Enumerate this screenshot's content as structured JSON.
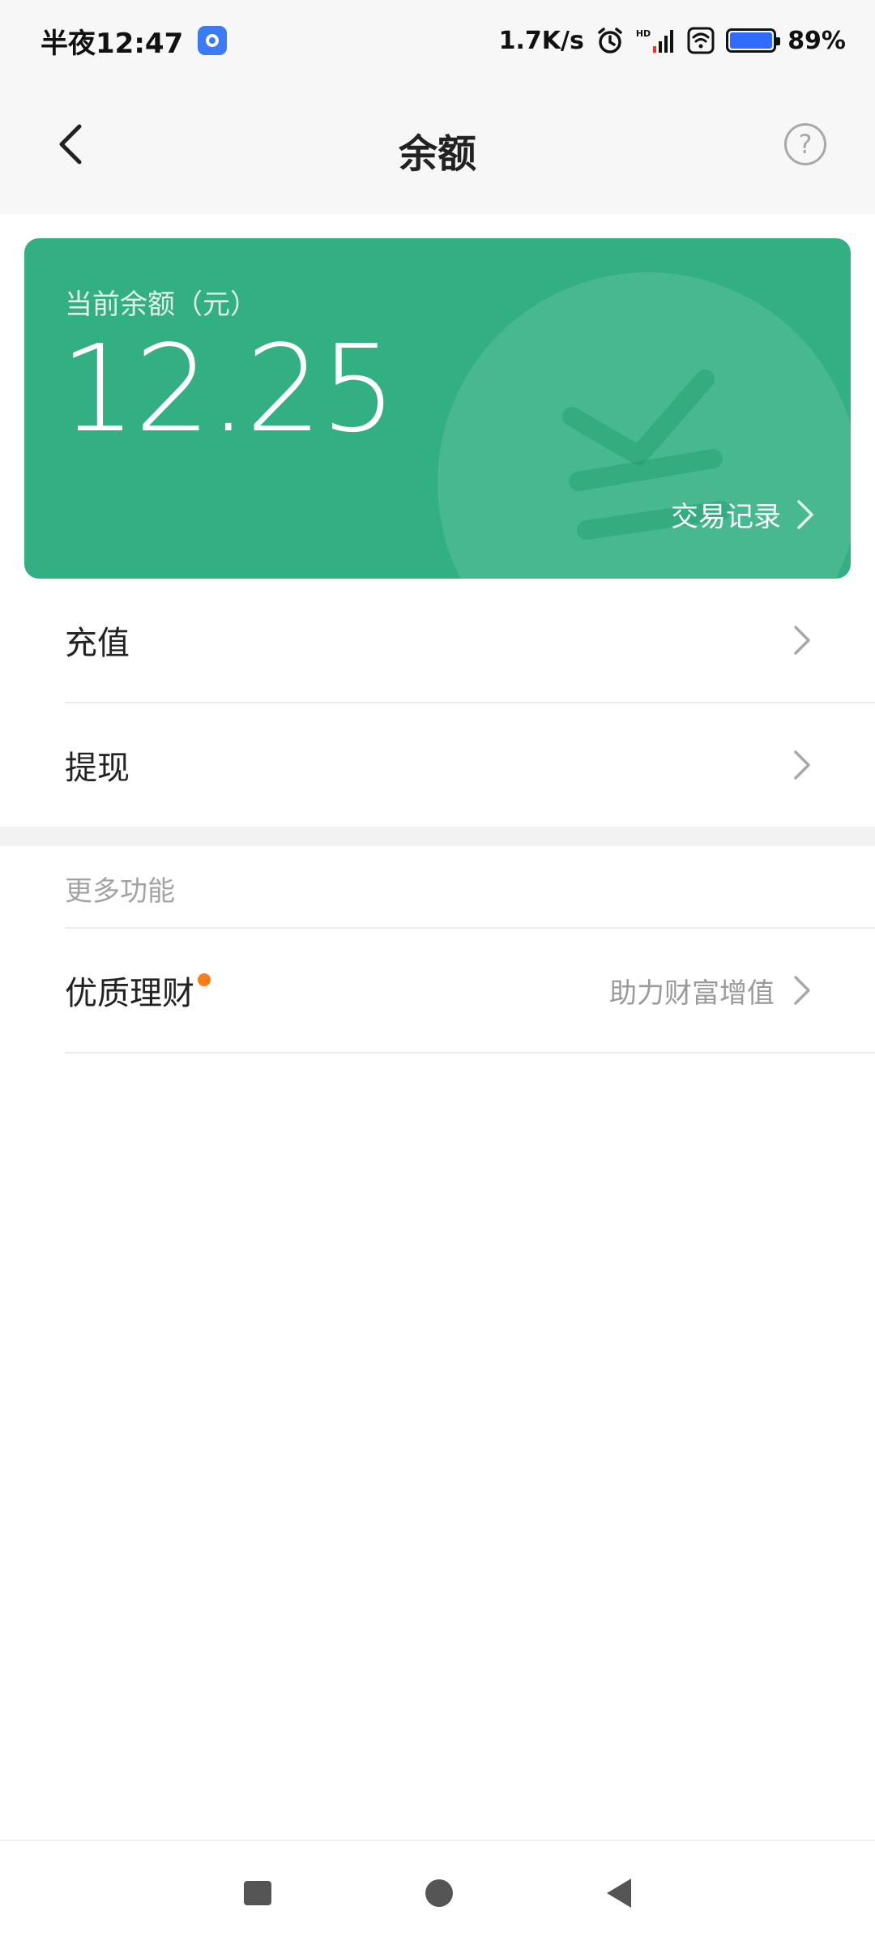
{
  "status_bar": {
    "time": "半夜12:47",
    "network_speed": "1.7K/s",
    "signal_label": "HD",
    "battery": "89%"
  },
  "header": {
    "title": "余额",
    "back_icon": "chevron-left-icon",
    "help_icon": "question-circle-icon",
    "help_glyph": "?"
  },
  "balance_card": {
    "label": "当前余额（元）",
    "amount": "12.25",
    "link_label": "交易记录",
    "bg_color": "#33b083"
  },
  "actions": [
    {
      "label": "充值"
    },
    {
      "label": "提现"
    }
  ],
  "more_section": {
    "title": "更多功能",
    "items": [
      {
        "label": "优质理财",
        "subtitle": "助力财富增值",
        "badge_color": "#ff7a18"
      }
    ]
  }
}
